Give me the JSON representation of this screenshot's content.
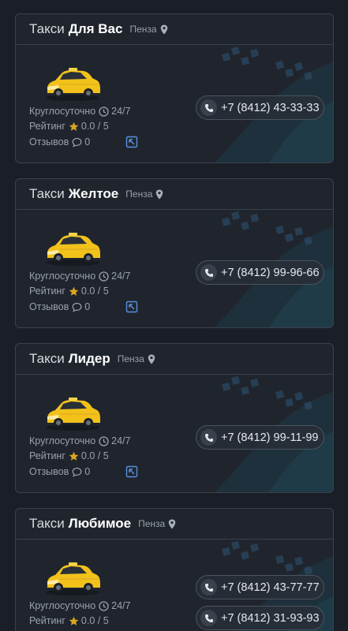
{
  "cards": [
    {
      "title_prefix": "Такси",
      "name": "Для Вас",
      "city": "Пенза",
      "hours_label": "Круглосуточно",
      "hours_value": "24/7",
      "rating_label": "Рейтинг",
      "rating_value": "0.0 / 5",
      "reviews_label": "Отзывов",
      "reviews_count": "0",
      "phones": [
        "+7 (8412) 43-33-33"
      ]
    },
    {
      "title_prefix": "Такси",
      "name": "Желтое",
      "city": "Пенза",
      "hours_label": "Круглосуточно",
      "hours_value": "24/7",
      "rating_label": "Рейтинг",
      "rating_value": "0.0 / 5",
      "reviews_label": "Отзывов",
      "reviews_count": "0",
      "phones": [
        "+7 (8412) 99-96-66"
      ]
    },
    {
      "title_prefix": "Такси",
      "name": "Лидер",
      "city": "Пенза",
      "hours_label": "Круглосуточно",
      "hours_value": "24/7",
      "rating_label": "Рейтинг",
      "rating_value": "0.0 / 5",
      "reviews_label": "Отзывов",
      "reviews_count": "0",
      "phones": [
        "+7 (8412) 99-11-99"
      ]
    },
    {
      "title_prefix": "Такси",
      "name": "Любимое",
      "city": "Пенза",
      "hours_label": "Круглосуточно",
      "hours_value": "24/7",
      "rating_label": "Рейтинг",
      "rating_value": "0.0 / 5",
      "phones": [
        "+7 (8412) 43-77-77",
        "+7 (8412) 31-93-93"
      ]
    }
  ],
  "icons": {
    "location": "map-pin-icon",
    "hours": "clock-icon",
    "rating": "star-icon",
    "reviews": "speech-bubble-icon",
    "open": "external-link-icon",
    "call": "phone-icon",
    "image": "yellow-taxi-car"
  },
  "colors": {
    "background": "#1a1f27",
    "card": "#20252d",
    "accent_star": "#d9a520",
    "link_icon": "#5a8fe0",
    "car_yellow": "#f2c21b"
  }
}
